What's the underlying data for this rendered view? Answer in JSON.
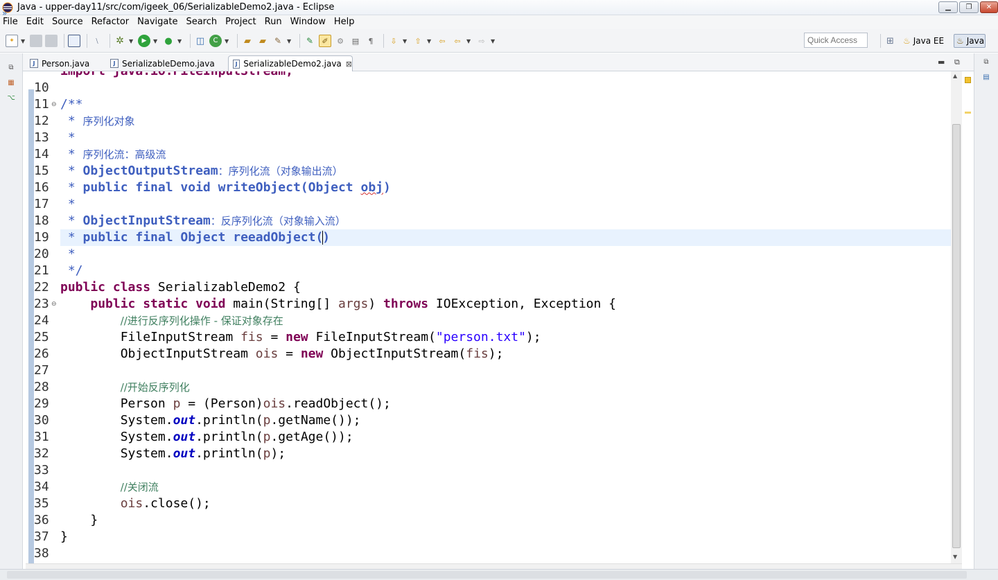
{
  "window": {
    "title": "Java - upper-day11/src/com/igeek_06/SerializableDemo2.java - Eclipse",
    "minimize_glyph": "▁",
    "maximize_glyph": "❐",
    "close_glyph": "✕"
  },
  "menu": [
    "File",
    "Edit",
    "Source",
    "Refactor",
    "Navigate",
    "Search",
    "Project",
    "Run",
    "Window",
    "Help"
  ],
  "toolbar": {
    "quick_access_placeholder": "Quick Access",
    "perspectives": [
      "Java EE",
      "Java"
    ]
  },
  "tabs": [
    {
      "label": "Person.java",
      "active": false
    },
    {
      "label": "SerializableDemo.java",
      "active": false
    },
    {
      "label": "SerializableDemo2.java",
      "active": true
    }
  ],
  "tab_close_glyph": "⊠",
  "editor": {
    "partial_top_line": "import java.io.FileInputStream;",
    "line_numbers": [
      "10",
      "11",
      "12",
      "13",
      "14",
      "15",
      "16",
      "17",
      "18",
      "19",
      "20",
      "21",
      "22",
      "23",
      "24",
      "25",
      "26",
      "27",
      "28",
      "29",
      "30",
      "31",
      "32",
      "33",
      "34",
      "35",
      "36",
      "37",
      "38"
    ],
    "fold_markers": {
      "11": "⊖",
      "23": "⊖"
    },
    "current_line": "19",
    "code": {
      "l11": "/**",
      "l12_star": " * ",
      "l12_text": "序列化对象",
      "l13": " *",
      "l14_star": " * ",
      "l14_text": "序列化流：高级流",
      "l15_star": " * ",
      "l15_class": "ObjectOutputStream",
      "l15_text": "：序列化流（对象输出流）",
      "l16_star": " * ",
      "l16_a": "public final void writeObject(Object ",
      "l16_obj": "obj",
      "l16_b": ")",
      "l17": " *",
      "l18_star": " * ",
      "l18_class": "ObjectInputStream",
      "l18_text": "：反序列化流（对象输入流）",
      "l19_star": " * ",
      "l19_a": "public final Object reeadObject(",
      "l19_b": ")",
      "l20": " *",
      "l21": " */",
      "l22_kw": "public class",
      "l22_rest": " SerializableDemo2 {",
      "l23_indent": "    ",
      "l23_kw": "public static void",
      "l23_a": " main(String[] ",
      "l23_args": "args",
      "l23_b": ") ",
      "l23_throws": "throws",
      "l23_c": " IOException, Exception {",
      "l24_indent": "        ",
      "l24_cmt": "//进行反序列化操作 - 保证对象存在",
      "l25_indent": "        ",
      "l25_a": "FileInputStream ",
      "l25_fis": "fis",
      "l25_b": " = ",
      "l25_new": "new",
      "l25_c": " FileInputStream(",
      "l25_str": "\"person.txt\"",
      "l25_d": ");",
      "l26_indent": "        ",
      "l26_a": "ObjectInputStream ",
      "l26_ois": "ois",
      "l26_b": " = ",
      "l26_new": "new",
      "l26_c": " ObjectInputStream(",
      "l26_fis": "fis",
      "l26_d": ");",
      "l28_indent": "        ",
      "l28_cmt": "//开始反序列化",
      "l29_indent": "        ",
      "l29_a": "Person ",
      "l29_p": "p",
      "l29_b": " = (Person)",
      "l29_ois": "ois",
      "l29_c": ".readObject();",
      "l30_indent": "        ",
      "l30_a": "System.",
      "l30_out": "out",
      "l30_b": ".println(",
      "l30_p": "p",
      "l30_c": ".getName());",
      "l31_indent": "        ",
      "l31_a": "System.",
      "l31_out": "out",
      "l31_b": ".println(",
      "l31_p": "p",
      "l31_c": ".getAge());",
      "l32_indent": "        ",
      "l32_a": "System.",
      "l32_out": "out",
      "l32_b": ".println(",
      "l32_p": "p",
      "l32_c": ");",
      "l34_indent": "        ",
      "l34_cmt": "//关闭流",
      "l35_indent": "        ",
      "l35_ois": "ois",
      "l35_a": ".close();",
      "l36": "    }",
      "l37": "}"
    }
  },
  "colors": {
    "keyword": "#7f0055",
    "javadoc": "#3f5fbf",
    "comment": "#3f7f5f",
    "string": "#2a00ff",
    "static_field": "#0000c0",
    "local_var": "#6a3e3e",
    "current_line_bg": "#e8f2fe"
  }
}
